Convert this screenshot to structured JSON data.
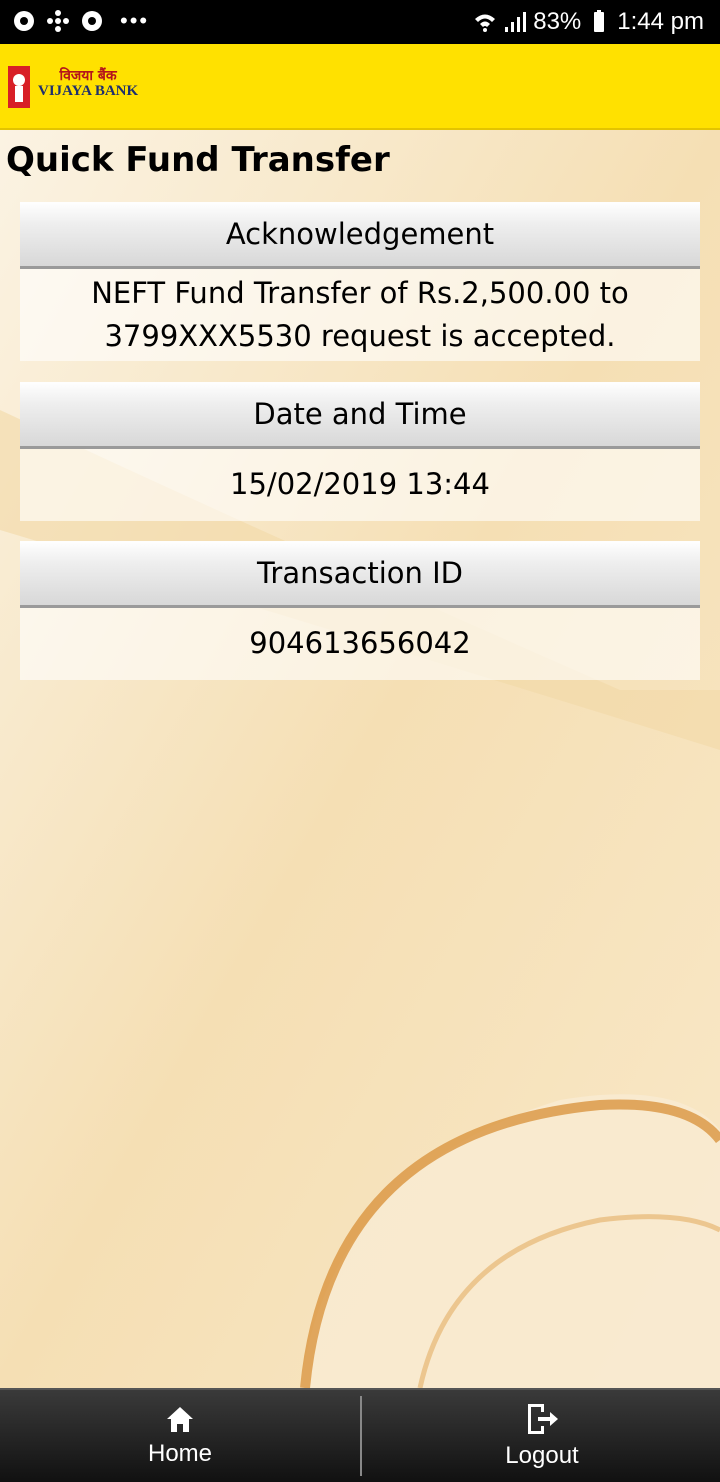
{
  "status_bar": {
    "battery": "83%",
    "time": "1:44 pm",
    "icons": [
      "chrome-icon",
      "fan-icon",
      "chrome-icon",
      "more-dots-icon",
      "wifi-icon",
      "signal-icon",
      "battery-icon"
    ]
  },
  "header": {
    "logo": {
      "hindi": "विजया बैंक",
      "english": "VIJAYA BANK"
    },
    "background": "#ffe100"
  },
  "page": {
    "title": "Quick Fund Transfer"
  },
  "sections": [
    {
      "header": "Acknowledgement",
      "value_lines": [
        "NEFT Fund Transfer of Rs.2,500.00 to",
        "3799XXX5530 request is accepted."
      ]
    },
    {
      "header": "Date and Time",
      "value": "15/02/2019 13:44"
    },
    {
      "header": "Transaction ID",
      "value": "904613656042"
    }
  ],
  "bottom_nav": {
    "home_label": "Home",
    "logout_label": "Logout"
  }
}
